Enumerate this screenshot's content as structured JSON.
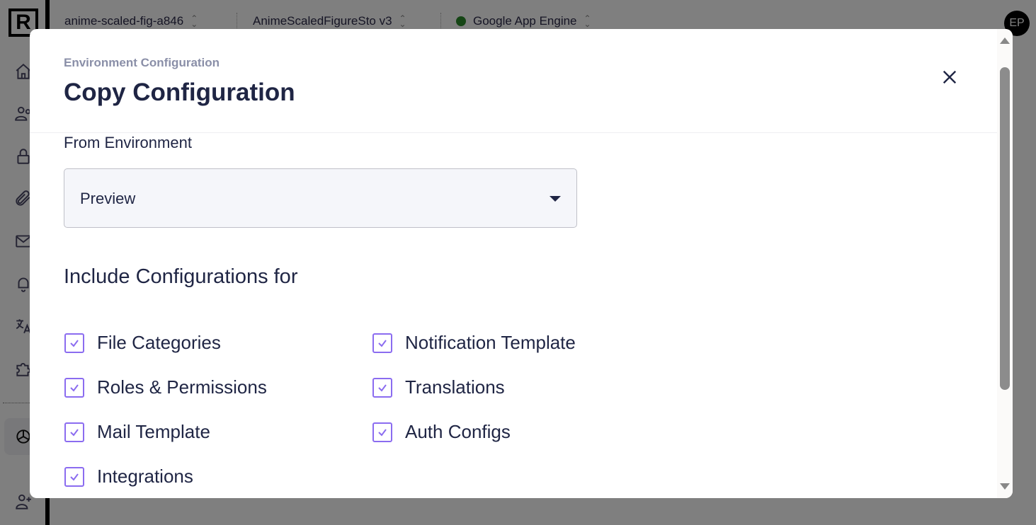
{
  "app": {
    "logo_letter": "R",
    "topbar": {
      "project": "anime-scaled-fig-a846",
      "app_version": "AnimeScaledFigureSto v3",
      "environment": "Google App Engine",
      "environment_status_color": "#2a8a2a",
      "avatar_initials": "EP"
    },
    "sidebar": {
      "items": [
        {
          "icon": "home-icon"
        },
        {
          "icon": "users-icon"
        },
        {
          "icon": "lock-icon"
        },
        {
          "icon": "paperclip-icon"
        },
        {
          "icon": "mail-icon"
        },
        {
          "icon": "bell-icon"
        },
        {
          "icon": "translate-icon"
        },
        {
          "icon": "puzzle-icon"
        },
        {
          "icon": "settings-gear-icon",
          "active": true
        },
        {
          "icon": "add-user-icon"
        }
      ]
    }
  },
  "modal": {
    "eyebrow": "Environment Configuration",
    "title": "Copy Configuration",
    "from_label": "From Environment",
    "from_value": "Preview",
    "section_title": "Include Configurations for",
    "accent_color": "#8b6cf0",
    "options": [
      {
        "label": "File Categories",
        "checked": true
      },
      {
        "label": "Notification Template",
        "checked": true
      },
      {
        "label": "Roles & Permissions",
        "checked": true
      },
      {
        "label": "Translations",
        "checked": true
      },
      {
        "label": "Mail Template",
        "checked": true
      },
      {
        "label": "Auth Configs",
        "checked": true
      },
      {
        "label": "Integrations",
        "checked": true
      }
    ]
  }
}
